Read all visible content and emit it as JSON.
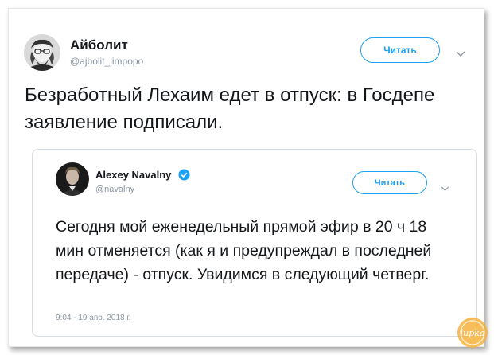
{
  "tweet": {
    "display_name": "Айболит",
    "handle": "@ajbolit_limpopo",
    "follow_label": "Читать",
    "text": "Безработный Лехаим едет в отпуск: в Госдепе заявление подписали."
  },
  "quoted_tweet": {
    "display_name": "Alexey Navalny",
    "handle": "@navalny",
    "follow_label": "Читать",
    "text": "Сегодня мой еженедельный прямой эфир в 20 ч 18 мин отменяется (как я и предупреждал в последней передаче) - отпуск. Увидимся в следующий четверг.",
    "timestamp": "9:04 - 19 апр. 2018 г."
  },
  "colors": {
    "accent": "#1da1f2",
    "muted": "#8a96a3",
    "text": "#14171a"
  },
  "icons": {
    "verified": "verified-badge-icon",
    "menu": "chevron-down-icon",
    "watermark": "lupa-watermark-logo"
  },
  "watermark": {
    "text": "lupka"
  }
}
